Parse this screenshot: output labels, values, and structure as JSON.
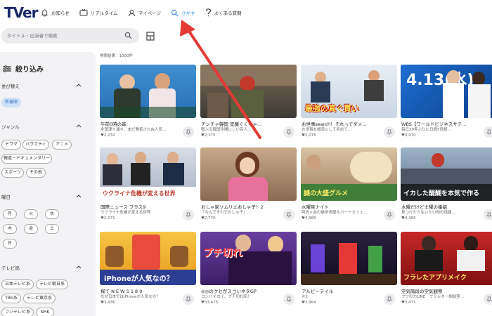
{
  "header": {
    "logo": "TVer",
    "nav": [
      {
        "label": "お知らせ",
        "icon": "bell-icon"
      },
      {
        "label": "リアルタイム",
        "icon": "tv-icon"
      },
      {
        "label": "マイページ",
        "icon": "user-icon"
      },
      {
        "label": "さがす",
        "icon": "search-icon"
      },
      {
        "label": "よくある質問",
        "icon": "question-icon"
      }
    ]
  },
  "search": {
    "placeholder": "タイトル・出演者で検索"
  },
  "sidebar": {
    "title": "絞り込み",
    "sort": {
      "title": "並び替え",
      "chips": [
        "新着順"
      ]
    },
    "genre": {
      "title": "ジャンル",
      "chips": [
        "ドラマ",
        "バラエティ",
        "アニメ",
        "報道・ドキュメンタリー",
        "スポーツ",
        "その他"
      ]
    },
    "weekday": {
      "title": "曜日",
      "chips": [
        "月",
        "火",
        "水",
        "木",
        "金",
        "土",
        "日"
      ]
    },
    "station": {
      "title": "テレビ局",
      "chips": [
        "日本テレビ系",
        "テレビ朝日系",
        "TBS系",
        "テレビ東京系",
        "フジテレビ系",
        "NHK"
      ]
    }
  },
  "results": {
    "label": "検索結果｜1000件"
  },
  "cards": [
    {
      "title": "午前0時の森",
      "sub": "全国津々浦々、未だ開拓されぬ人気…",
      "fav": "♥2,232",
      "thumb_text": ""
    },
    {
      "title": "チンチャ韓国 覚醒ぐくちゃ…",
      "sub": "噂ぶる韓国全開にしい芸人…",
      "fav": "♥2,375",
      "thumb_text": ""
    },
    {
      "title": "お世事search！それってダメ…",
      "sub": "お世事を細幸にして初めて…",
      "fav": "♥2,075",
      "thumb_text": "最強の真ぐ貫い"
    },
    {
      "title": "WBS【ワールドビジネスサテ…",
      "sub": "毎日20年ぶりに日経5倍超…",
      "fav": "♥3,970",
      "thumb_text": "4.13(水)"
    },
    {
      "title": "国際ニュース プラス9",
      "sub": "ウクライナ危機が変える世界",
      "fav": "♥2,571",
      "thumb_text": "ウクライナ危機が変える世界"
    },
    {
      "title": "おしゃ家ソムリエおしゃ子！2",
      "sub": "「なんでそれでおしゃ子」…",
      "fav": "♥2,770",
      "thumb_text": ""
    },
    {
      "title": "水曜見ナイト",
      "sub": "阿佐ヶ谷の巻学舎屋＆バードカフェ…",
      "fav": "♥4,385",
      "thumb_text": "謎の大盛グルメ"
    },
    {
      "title": "水曜だけど土曜の番組",
      "sub": "見つけたら生いたい他の話題…",
      "fav": "♥4,365",
      "thumb_text": "イカした醍醐を本気で作る"
    },
    {
      "title": "探て N E W S 1 8 0",
      "sub": "なぜ日本ではiPhoneが人気なの？",
      "fav": "♥3,436",
      "thumb_text": "iPhoneが人気なの？"
    },
    {
      "title": "◎◎のクセがスゴいネタGP",
      "sub": "コンパイロイ、プチ切れ回！",
      "fav": "♥33,475",
      "thumb_text": "プチ切れ"
    },
    {
      "title": "アルピーテイル",
      "sub": "＃2",
      "fav": "♥3,964",
      "thumb_text": ""
    },
    {
      "title": "空気階段の空気観察",
      "sub": "フワの力LINE　フラレター相談室…",
      "fav": "♥3,475",
      "thumb_text": "フラレたアプリメイク"
    }
  ]
}
